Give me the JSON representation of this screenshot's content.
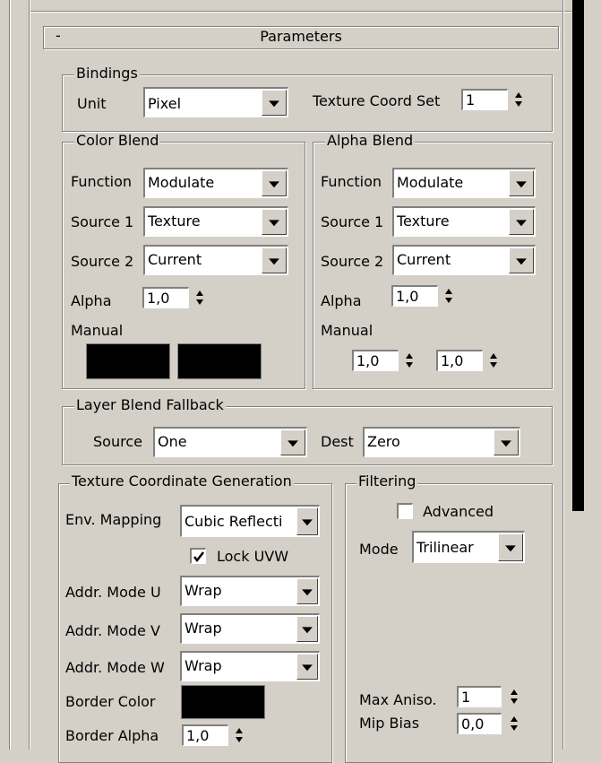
{
  "rollout": {
    "toggle": "-",
    "title": "Parameters"
  },
  "bindings": {
    "title": "Bindings",
    "unit_label": "Unit",
    "unit_value": "Pixel",
    "tex_coord_label": "Texture Coord Set",
    "tex_coord_value": "1"
  },
  "color_blend": {
    "title": "Color Blend",
    "function_label": "Function",
    "function_value": "Modulate",
    "source1_label": "Source 1",
    "source1_value": "Texture",
    "source2_label": "Source 2",
    "source2_value": "Current",
    "alpha_label": "Alpha",
    "alpha_value": "1,0",
    "manual_label": "Manual",
    "manual_color_1": "#000000",
    "manual_color_2": "#000000"
  },
  "alpha_blend": {
    "title": "Alpha Blend",
    "function_label": "Function",
    "function_value": "Modulate",
    "source1_label": "Source 1",
    "source1_value": "Texture",
    "source2_label": "Source 2",
    "source2_value": "Current",
    "alpha_label": "Alpha",
    "alpha_value": "1,0",
    "manual_label": "Manual",
    "manual_value_1": "1,0",
    "manual_value_2": "1,0"
  },
  "layer_blend": {
    "title": "Layer Blend Fallback",
    "source_label": "Source",
    "source_value": "One",
    "dest_label": "Dest",
    "dest_value": "Zero"
  },
  "tex_gen": {
    "title": "Texture Coordinate Generation",
    "env_label": "Env. Mapping",
    "env_value": "Cubic Reflecti",
    "lock_label": "Lock UVW",
    "lock_checked": true,
    "addr_u_label": "Addr. Mode U",
    "addr_u_value": "Wrap",
    "addr_v_label": "Addr. Mode V",
    "addr_v_value": "Wrap",
    "addr_w_label": "Addr. Mode W",
    "addr_w_value": "Wrap",
    "border_color_label": "Border Color",
    "border_color": "#000000",
    "border_alpha_label": "Border Alpha",
    "border_alpha_value": "1,0"
  },
  "filtering": {
    "title": "Filtering",
    "advanced_label": "Advanced",
    "advanced_checked": false,
    "mode_label": "Mode",
    "mode_value": "Trilinear",
    "max_aniso_label": "Max Aniso.",
    "max_aniso_value": "1",
    "mip_bias_label": "Mip Bias",
    "mip_bias_value": "0,0"
  }
}
